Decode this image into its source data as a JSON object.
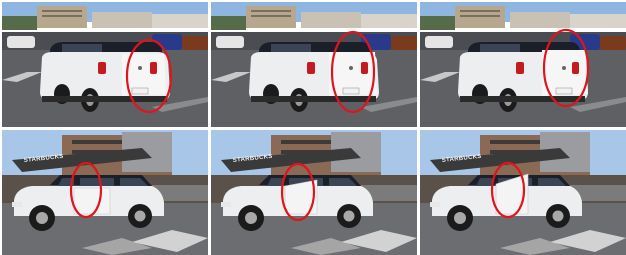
{
  "layout": {
    "rows": 2,
    "columns": 3
  },
  "panels": [
    {
      "row": "top",
      "view": "rear",
      "door": "closed",
      "sign_text": ""
    },
    {
      "row": "top",
      "view": "rear",
      "door": "opening",
      "sign_text": ""
    },
    {
      "row": "top",
      "view": "rear",
      "door": "open",
      "sign_text": ""
    },
    {
      "row": "bottom",
      "view": "side",
      "door": "closed",
      "sign_text": "STARBUCKS"
    },
    {
      "row": "bottom",
      "view": "side",
      "door": "opening",
      "sign_text": "STARBUCKS"
    },
    {
      "row": "bottom",
      "view": "side",
      "door": "open",
      "sign_text": "STARBUCKS"
    }
  ],
  "colors": {
    "highlight_ellipse": "#e0141b",
    "car_body": "#eceef0",
    "car_roof": "#1b1f2a",
    "asphalt": "#5d5f63",
    "sky": "#9fc3ea"
  }
}
